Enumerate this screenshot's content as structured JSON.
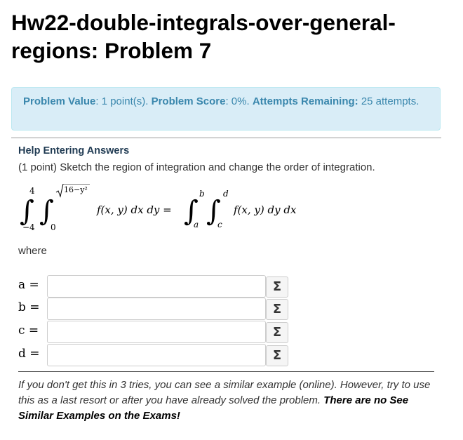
{
  "page": {
    "title": "Hw22-double-integrals-over-general-regions: Problem 7"
  },
  "problem_info": {
    "value_label": "Problem Value",
    "value_text": ": 1 point(s). ",
    "score_label": "Problem Score",
    "score_text": ": 0%. ",
    "attempts_label": "Attempts Remaining:",
    "attempts_text": " 25 attempts."
  },
  "help": {
    "link_label": "Help Entering Answers"
  },
  "problem": {
    "statement": "(1 point) Sketch the region of integration and change the order of integration.",
    "equation": {
      "outer_lower": "−4",
      "outer_upper": "4",
      "inner_lower": "0",
      "inner_upper_radicand": "16−y²",
      "integrand_left": "f(x, y) dx dy =",
      "right_outer_lower": "a",
      "right_outer_upper": "b",
      "right_inner_lower": "c",
      "right_inner_upper": "d",
      "integrand_right": "f(x, y) dy dx"
    },
    "where_label": "where"
  },
  "answers": [
    {
      "label": "a =",
      "value": "",
      "button": "Σ"
    },
    {
      "label": "b =",
      "value": "",
      "button": "Σ"
    },
    {
      "label": "c =",
      "value": "",
      "button": "Σ"
    },
    {
      "label": "d =",
      "value": "",
      "button": "Σ"
    }
  ],
  "footer": {
    "note": "If you don't get this in 3 tries, you can see a similar example (online). However, try to use this as a last resort or after you have already solved the problem. ",
    "note_strong": "There are no See Similar Examples on the Exams!"
  }
}
